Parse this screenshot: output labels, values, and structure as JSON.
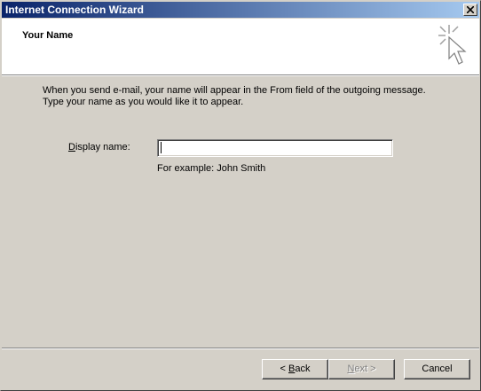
{
  "window": {
    "title": "Internet Connection Wizard"
  },
  "header": {
    "title": "Your Name"
  },
  "body": {
    "description_line1": "When you send e-mail, your name will appear in the From field of the outgoing message.",
    "description_line2": "Type your name as you would like it to appear.",
    "display_name_label_accel": "D",
    "display_name_label_rest": "isplay name:",
    "display_name_value": "",
    "example_text": "For example: John Smith"
  },
  "buttons": {
    "back_prefix": "< ",
    "back_accel": "B",
    "back_rest": "ack",
    "next_accel": "N",
    "next_rest": "ext >",
    "cancel": "Cancel",
    "next_enabled": false
  },
  "icons": {
    "close": "close-icon",
    "wizard": "wizard-cursor-icon"
  },
  "colors": {
    "titlebar_start": "#0a246a",
    "titlebar_end": "#a6caf0",
    "dialog_bg": "#d4d0c8"
  }
}
